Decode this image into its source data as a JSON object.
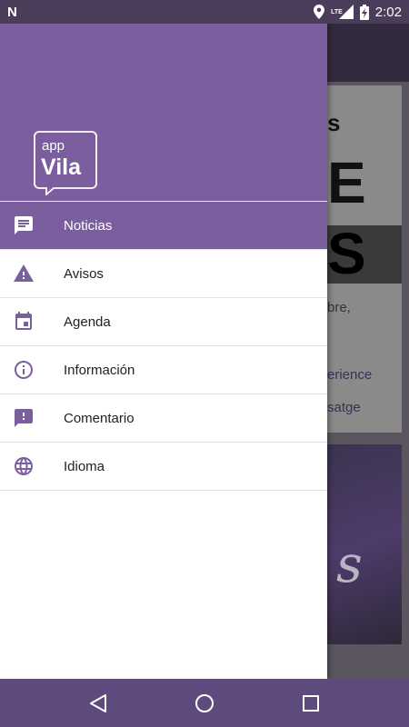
{
  "status_bar": {
    "time": "2:02",
    "network": "LTE",
    "icons": [
      "notification-n-icon",
      "location-icon",
      "signal-icon",
      "battery-charging-icon"
    ]
  },
  "drawer": {
    "logo": {
      "top_text": "app",
      "main_text": "Vila"
    },
    "items": [
      {
        "label": "Noticias",
        "icon": "chat-icon",
        "active": true
      },
      {
        "label": "Avisos",
        "icon": "warning-icon",
        "active": false
      },
      {
        "label": "Agenda",
        "icon": "calendar-icon",
        "active": false
      },
      {
        "label": "Información",
        "icon": "info-icon",
        "active": false
      },
      {
        "label": "Comentario",
        "icon": "feedback-icon",
        "active": false
      },
      {
        "label": "Idioma",
        "icon": "globe-icon",
        "active": false
      }
    ]
  },
  "background": {
    "card1_letter_small": "s",
    "card1_letter_e": "E",
    "card1_letter_s": "S",
    "card1_text_1": "bre,",
    "card1_text_2": "erience",
    "card1_text_3": "satge",
    "card2_script": "s"
  },
  "nav_bar": {
    "buttons": [
      "back-icon",
      "home-icon",
      "recents-icon"
    ]
  },
  "colors": {
    "primary": "#7a5e9e",
    "status_bar": "#4a3d5a",
    "nav_bar": "#5e4a7d",
    "icon": "#7a5e9e"
  }
}
